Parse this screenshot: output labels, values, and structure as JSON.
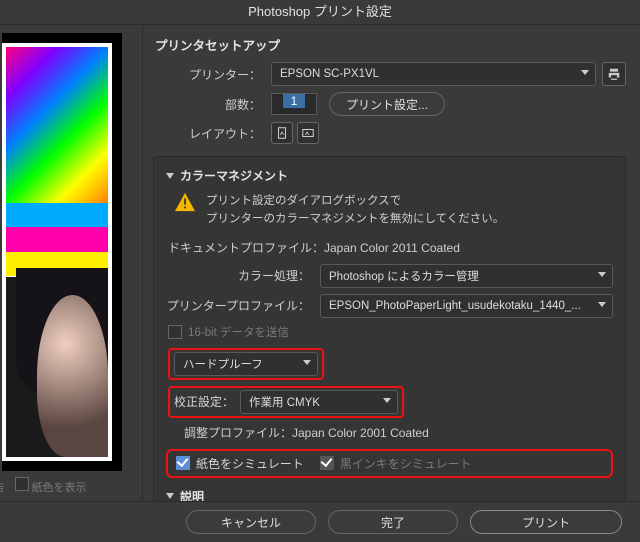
{
  "window_title": "Photoshop プリント設定",
  "printer_setup": {
    "title": "プリンタセットアップ",
    "printer_label": "プリンター：",
    "printer_value": "EPSON SC-PX1VL",
    "copies_label": "部数：",
    "copies_value": "1",
    "print_settings_btn": "プリント設定...",
    "layout_label": "レイアウト："
  },
  "color_mgmt": {
    "title": "カラーマネジメント",
    "warning_line1": "プリント設定のダイアログボックスで",
    "warning_line2": "プリンターのカラーマネジメントを無効にしてください。",
    "doc_profile_text": "ドキュメントプロファイル：Japan Color 2011 Coated",
    "handling_label": "カラー処理：",
    "handling_value": "Photoshop によるカラー管理",
    "printer_profile_label": "プリンタープロファイル：",
    "printer_profile_value": "EPSON_PhotoPaperLight_usudekotaku_1440_...",
    "send16_label": "16-bit データを送信",
    "rendering_value": "ハードプルーフ",
    "proof_label": "校正設定：",
    "proof_value": "作業用 CMYK",
    "adjust_profile_text": "調整プロファイル：Japan Color 2001 Coated",
    "sim_paper_label": "紙色をシミュレート",
    "sim_black_label": "黒インキをシミュレート",
    "description_title": "説明"
  },
  "footer": {
    "warn_label": "警告",
    "paper_label": "紙色を表示",
    "cancel": "キャンセル",
    "done": "完了",
    "print": "プリント"
  }
}
